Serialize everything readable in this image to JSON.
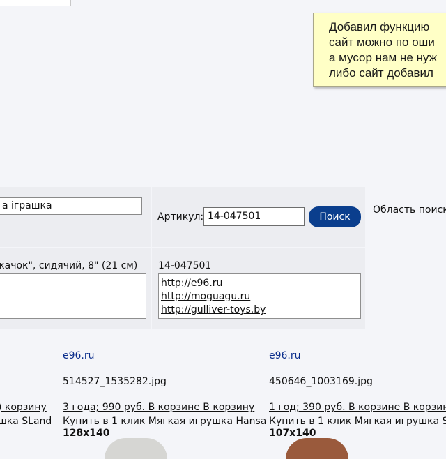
{
  "tooltip": {
    "lines": [
      "Добавил функцию",
      "сайт можно по оши",
      "а мусор нам не нуж",
      "либо сайт добавил"
    ]
  },
  "search": {
    "query_value": "а іграшка",
    "article_label": "Артикул:",
    "article_value": "14-047501",
    "button_label": "Поиск",
    "area_label": "Область поиск"
  },
  "product": {
    "name": "жачок\", сидячий, 8\" (21 см)",
    "article": "14-047501",
    "links": [
      "http://e96.ru",
      "http://moguagu.ru",
      "http://gulliver-toys.by"
    ]
  },
  "results": [
    {
      "site": "",
      "filename": "",
      "line1": ") корзину",
      "line2": "шка SLand",
      "dims": ""
    },
    {
      "site": "e96.ru",
      "filename": "514527_1535282.jpg",
      "line1": "3 года; 990 руб. В корзине В корзину",
      "line2": "Купить в 1 клик Мягкая игрушка Hansa",
      "dims": "128x140"
    },
    {
      "site": "e96.ru",
      "filename": "450646_1003169.jpg",
      "line1": "1 год; 390 руб. В корзине В корзину",
      "line2": "Купить в 1 клик Мягкая игрушка SL",
      "dims": "107x140"
    }
  ],
  "colors": {
    "button_bg": "#0a3e8d",
    "tooltip_bg": "#ffffc6",
    "site_link": "#0a2d8c"
  }
}
